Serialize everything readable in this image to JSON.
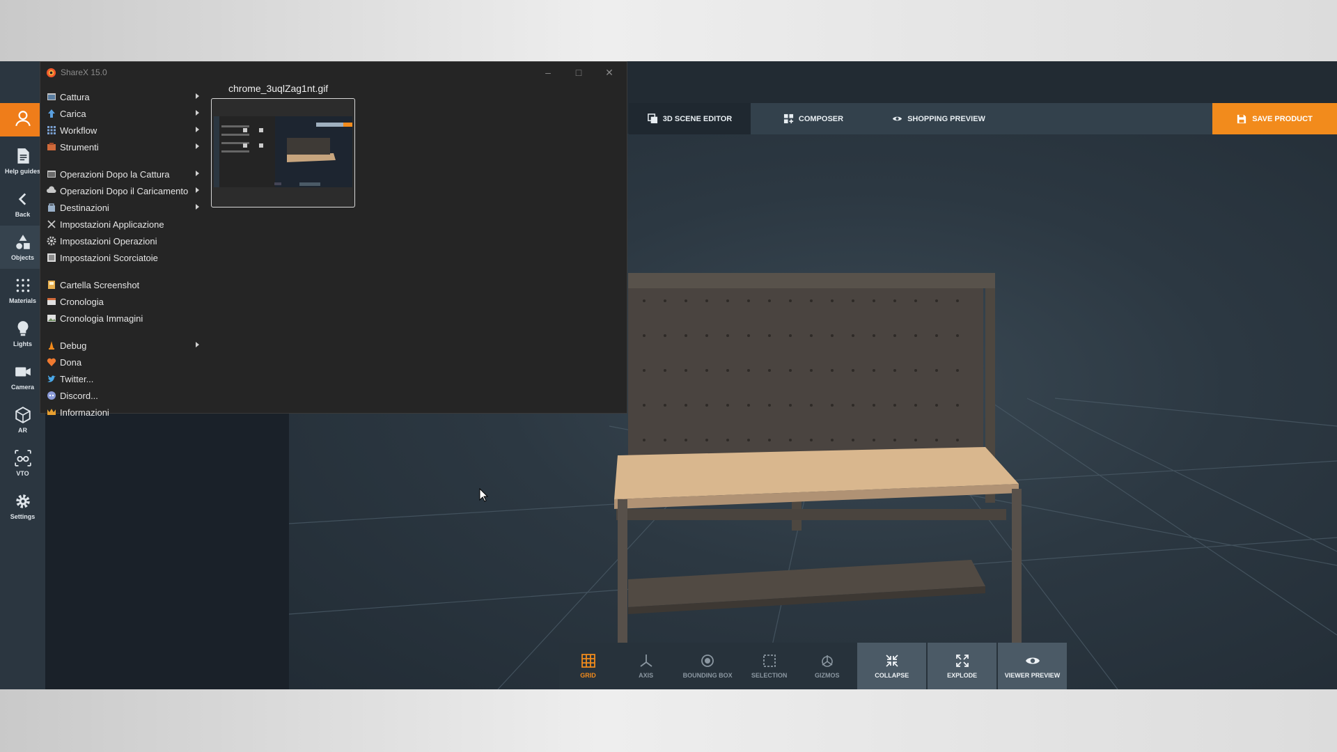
{
  "sharex": {
    "title": "ShareX 15.0",
    "thumbnail_filename": "chrome_3uqlZag1nt.gif",
    "menu": [
      {
        "label": "Cattura",
        "submenu": true,
        "icon": "capture-icon"
      },
      {
        "label": "Carica",
        "submenu": true,
        "icon": "upload-icon"
      },
      {
        "label": "Workflow",
        "submenu": true,
        "icon": "workflow-icon"
      },
      {
        "label": "Strumenti",
        "submenu": true,
        "icon": "tools-icon"
      },
      {
        "label": "Operazioni Dopo la Cattura",
        "submenu": true,
        "icon": "after-capture-icon"
      },
      {
        "label": "Operazioni Dopo il Caricamento",
        "submenu": true,
        "icon": "after-upload-icon"
      },
      {
        "label": "Destinazioni",
        "submenu": true,
        "icon": "destinations-icon"
      },
      {
        "label": "Impostazioni Applicazione",
        "submenu": false,
        "icon": "app-settings-icon"
      },
      {
        "label": "Impostazioni Operazioni",
        "submenu": false,
        "icon": "task-settings-icon"
      },
      {
        "label": "Impostazioni Scorciatoie",
        "submenu": false,
        "icon": "hotkey-settings-icon"
      },
      {
        "label": "Cartella Screenshot",
        "submenu": false,
        "icon": "folder-icon"
      },
      {
        "label": "Cronologia",
        "submenu": false,
        "icon": "history-icon"
      },
      {
        "label": "Cronologia Immagini",
        "submenu": false,
        "icon": "image-history-icon"
      },
      {
        "label": "Debug",
        "submenu": true,
        "icon": "debug-icon"
      },
      {
        "label": "Dona",
        "submenu": false,
        "icon": "heart-icon"
      },
      {
        "label": "Twitter...",
        "submenu": false,
        "icon": "twitter-icon"
      },
      {
        "label": "Discord...",
        "submenu": false,
        "icon": "discord-icon"
      },
      {
        "label": "Informazioni",
        "submenu": false,
        "icon": "crown-icon"
      }
    ]
  },
  "leftnav": {
    "items": [
      {
        "label": "Help guides",
        "icon": "document-icon"
      },
      {
        "label": "Back",
        "icon": "chevron-left-icon"
      },
      {
        "label": "Objects",
        "icon": "shapes-icon"
      },
      {
        "label": "Materials",
        "icon": "materials-icon"
      },
      {
        "label": "Lights",
        "icon": "bulb-icon"
      },
      {
        "label": "Camera",
        "icon": "camera-icon"
      },
      {
        "label": "AR",
        "icon": "ar-icon"
      },
      {
        "label": "VTO",
        "icon": "glasses-icon"
      },
      {
        "label": "Settings",
        "icon": "gear-icon"
      }
    ]
  },
  "tabs": [
    {
      "label": "3D SCENE EDITOR",
      "active": true
    },
    {
      "label": "COMPOSER",
      "active": false
    },
    {
      "label": "SHOPPING PREVIEW",
      "active": false
    }
  ],
  "save_button": "SAVE PRODUCT",
  "toolbar": [
    {
      "label": "GRID",
      "active": true
    },
    {
      "label": "AXIS"
    },
    {
      "label": "BOUNDING BOX"
    },
    {
      "label": "SELECTION"
    },
    {
      "label": "GIZMOS"
    },
    {
      "label": "COLLAPSE"
    },
    {
      "label": "EXPLODE"
    },
    {
      "label": "VIEWER PREVIEW"
    }
  ],
  "colors": {
    "accent": "#f28b1c",
    "app_bg": "#222b33",
    "nav_bg": "#2b3640",
    "sharex_bg": "#252525"
  }
}
